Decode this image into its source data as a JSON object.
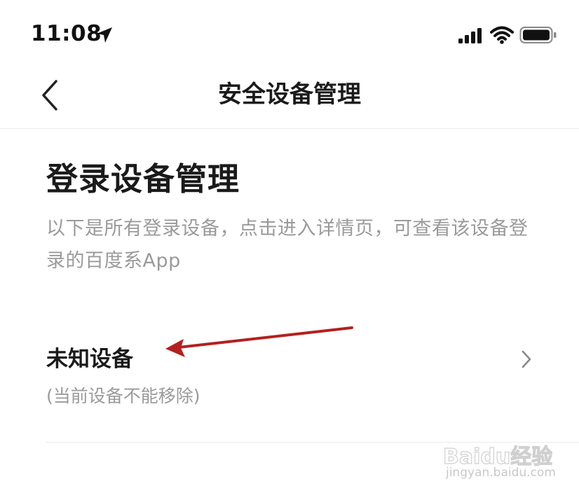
{
  "status_bar": {
    "time": "11:08"
  },
  "nav": {
    "title": "安全设备管理"
  },
  "section": {
    "title": "登录设备管理",
    "description": "以下是所有登录设备，点击进入详情页，可查看该设备登录的百度系App"
  },
  "devices": [
    {
      "name": "未知设备",
      "note": "(当前设备不能移除)"
    }
  ],
  "watermark": {
    "logo_text": "Baidu经验",
    "url": "jingyan.baidu.com"
  },
  "colors": {
    "annotation_arrow": "#b3201f",
    "secondary_text": "#9a9a9a"
  }
}
